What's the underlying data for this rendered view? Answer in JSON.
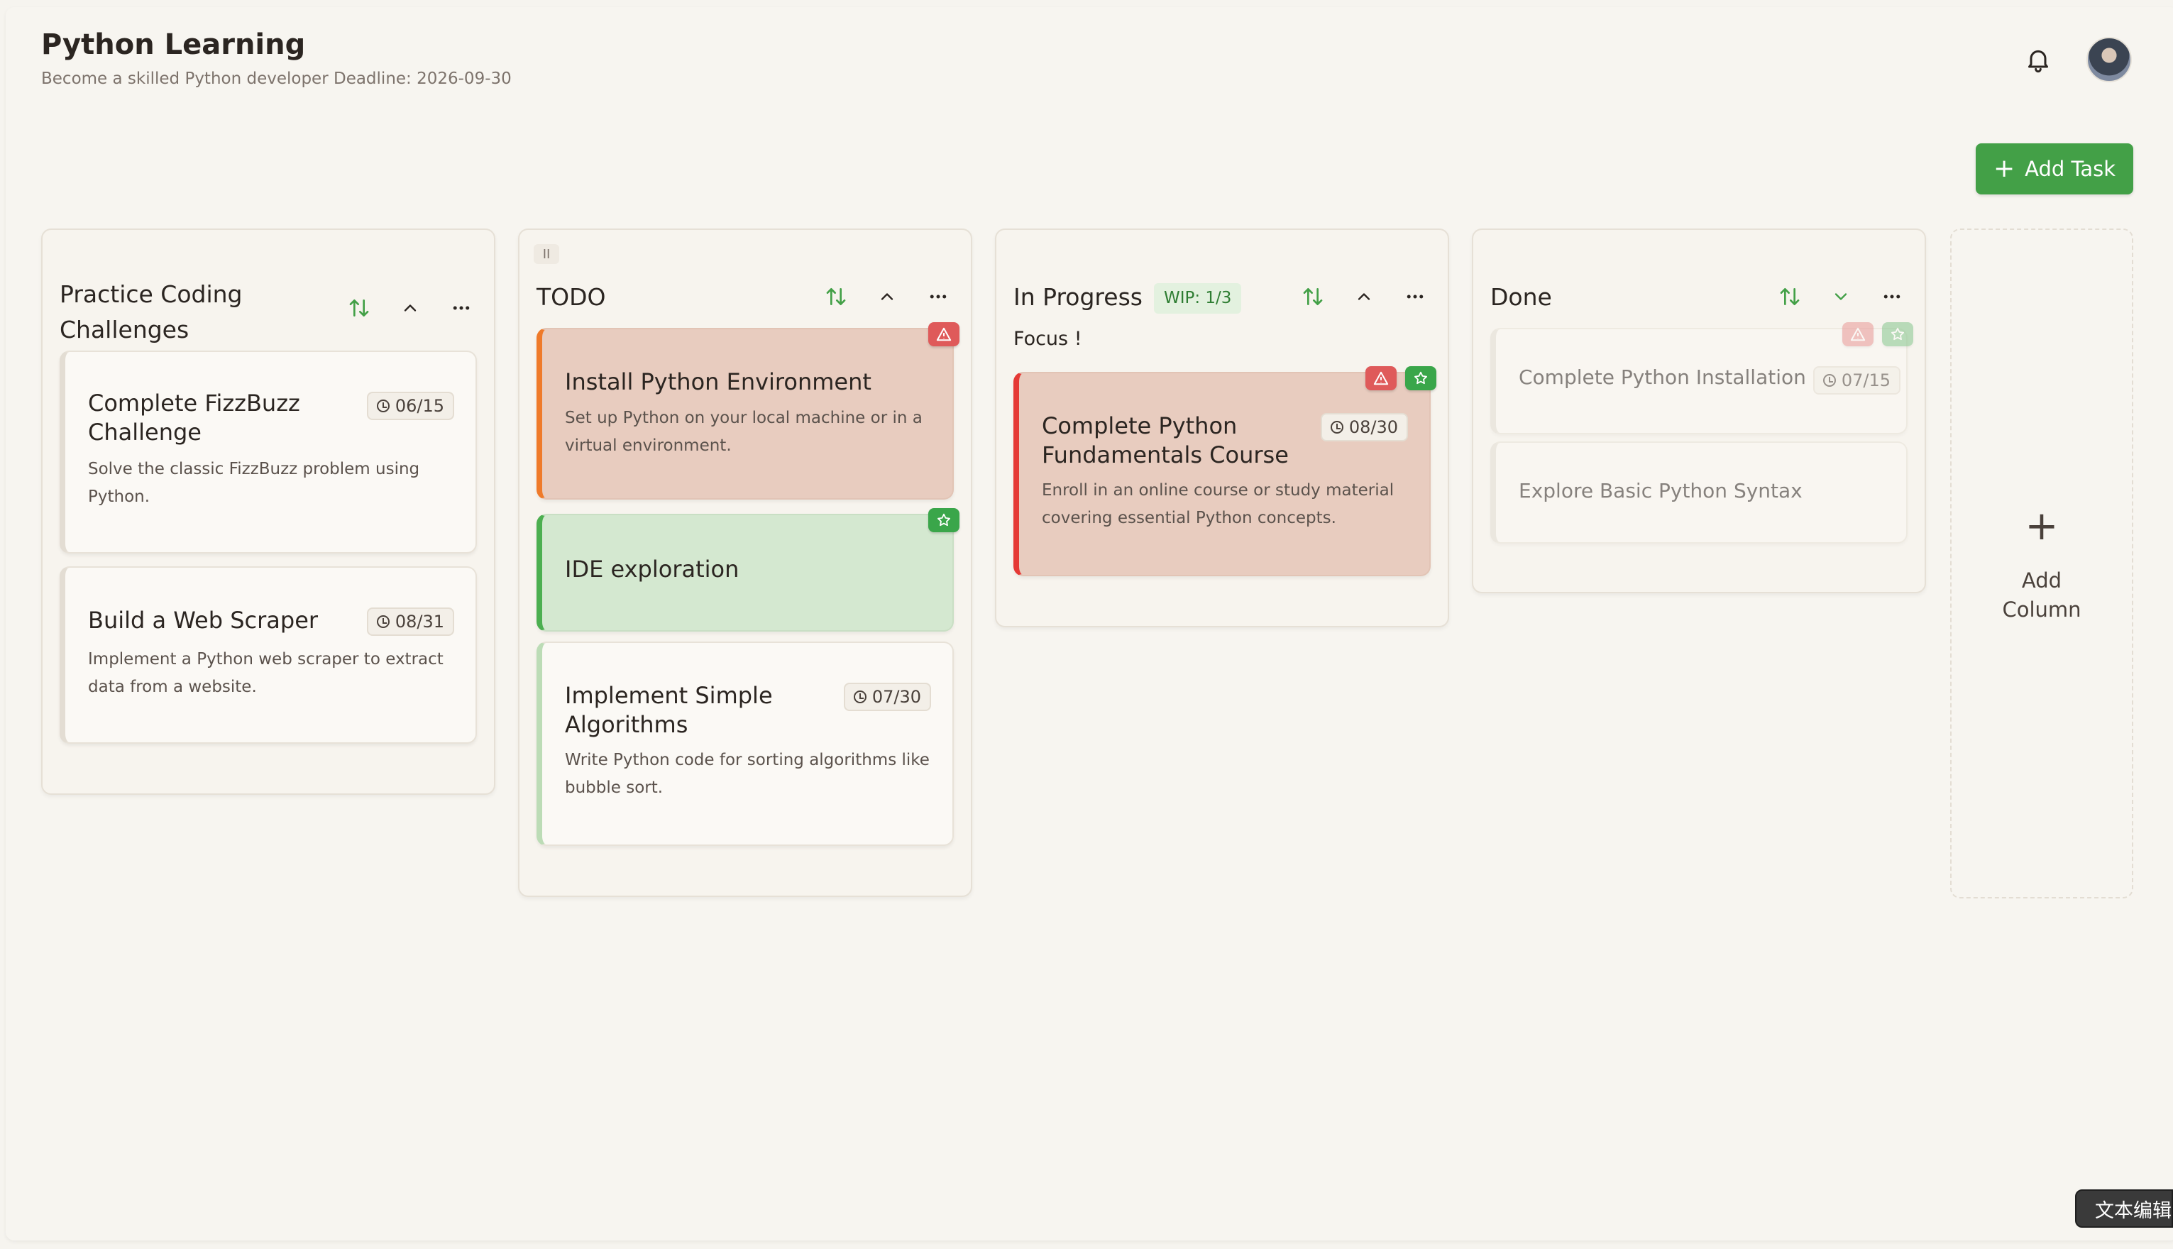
{
  "header": {
    "title": "Python Learning",
    "subtitle": "Become a skilled Python developer Deadline: 2026-09-30"
  },
  "toolbar": {
    "add_task_label": "Add Task"
  },
  "columns": [
    {
      "title": "Practice Coding Challenges",
      "cards": [
        {
          "title": "Complete FizzBuzz Challenge",
          "date": "06/15",
          "desc": "Solve the classic FizzBuzz problem using Python."
        },
        {
          "title": "Build a Web Scraper",
          "date": "08/31",
          "desc": "Implement a Python web scraper to extract data from a website."
        }
      ]
    },
    {
      "title": "TODO",
      "cards": [
        {
          "title": "Install Python Environment",
          "desc": "Set up Python on your local machine or in a virtual environment.",
          "tags": [
            "warning"
          ]
        },
        {
          "title": "IDE exploration",
          "tags": [
            "star"
          ]
        },
        {
          "title": "Implement Simple Algorithms",
          "date": "07/30",
          "desc": "Write Python code for sorting algorithms like bubble sort."
        }
      ]
    },
    {
      "title": "In Progress",
      "wip": "WIP: 1/3",
      "note": "Focus !",
      "cards": [
        {
          "title": "Complete Python Fundamentals Course",
          "date": "08/30",
          "desc": "Enroll in an online course or study material covering essential Python concepts.",
          "tags": [
            "warning",
            "star"
          ]
        }
      ]
    },
    {
      "title": "Done",
      "cards": [
        {
          "title": "Complete Python Installation",
          "date": "07/15",
          "tags": [
            "warning",
            "star"
          ]
        },
        {
          "title": "Explore Basic Python Syntax"
        }
      ]
    }
  ],
  "add_column": {
    "label": "Add Column"
  },
  "tooltip": {
    "text": "文本编辑"
  },
  "colors": {
    "accent": "#43a047",
    "warning_tag": "#df5a5a",
    "star_tag": "#3aa64a",
    "orange_border": "#ef7a2a",
    "red_border": "#e53935"
  },
  "icons": [
    "bell-icon",
    "avatar",
    "plus-icon",
    "sort-icon",
    "chevron-up-icon",
    "chevron-down-icon",
    "more-icon",
    "clock-icon",
    "warning-icon",
    "star-icon",
    "drag-handle-icon"
  ]
}
